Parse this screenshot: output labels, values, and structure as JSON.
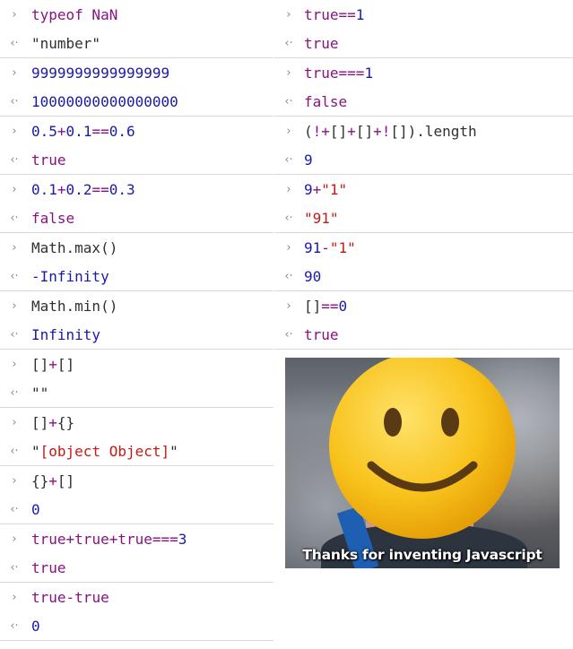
{
  "prompt_glyph": "›",
  "result_glyph": "‹·",
  "left": [
    {
      "input": [
        {
          "t": "typeof NaN",
          "c": "purple"
        }
      ],
      "output": [
        {
          "t": "\"number\"",
          "c": "black"
        }
      ]
    },
    {
      "input": [
        {
          "t": "9999999999999999",
          "c": "blue"
        }
      ],
      "output": [
        {
          "t": "10000000000000000",
          "c": "blue"
        }
      ]
    },
    {
      "input": [
        {
          "t": "0.5",
          "c": "blue"
        },
        {
          "t": "+",
          "c": "op"
        },
        {
          "t": "0.1",
          "c": "blue"
        },
        {
          "t": "==",
          "c": "op"
        },
        {
          "t": "0.6",
          "c": "blue"
        }
      ],
      "output": [
        {
          "t": "true",
          "c": "purple"
        }
      ]
    },
    {
      "input": [
        {
          "t": "0.1",
          "c": "blue"
        },
        {
          "t": "+",
          "c": "op"
        },
        {
          "t": "0.2",
          "c": "blue"
        },
        {
          "t": "==",
          "c": "op"
        },
        {
          "t": "0.3",
          "c": "blue"
        }
      ],
      "output": [
        {
          "t": "false",
          "c": "purple"
        }
      ]
    },
    {
      "input": [
        {
          "t": "Math.max()",
          "c": "black"
        }
      ],
      "output": [
        {
          "t": "-Infinity",
          "c": "blue"
        }
      ]
    },
    {
      "input": [
        {
          "t": "Math.min()",
          "c": "black"
        }
      ],
      "output": [
        {
          "t": "Infinity",
          "c": "blue"
        }
      ]
    },
    {
      "input": [
        {
          "t": "[]",
          "c": "black"
        },
        {
          "t": "+",
          "c": "op"
        },
        {
          "t": "[]",
          "c": "black"
        }
      ],
      "output": [
        {
          "t": "\"\"",
          "c": "black"
        }
      ]
    },
    {
      "input": [
        {
          "t": "[]",
          "c": "black"
        },
        {
          "t": "+",
          "c": "op"
        },
        {
          "t": "{}",
          "c": "black"
        }
      ],
      "output": [
        {
          "t": "\"",
          "c": "black"
        },
        {
          "t": "[object Object]",
          "c": "red"
        },
        {
          "t": "\"",
          "c": "black"
        }
      ]
    },
    {
      "input": [
        {
          "t": "{}",
          "c": "black"
        },
        {
          "t": "+",
          "c": "op"
        },
        {
          "t": "[]",
          "c": "black"
        }
      ],
      "output": [
        {
          "t": "0",
          "c": "blue"
        }
      ]
    },
    {
      "input": [
        {
          "t": "true",
          "c": "purple"
        },
        {
          "t": "+",
          "c": "op"
        },
        {
          "t": "true",
          "c": "purple"
        },
        {
          "t": "+",
          "c": "op"
        },
        {
          "t": "true",
          "c": "purple"
        },
        {
          "t": "===",
          "c": "op"
        },
        {
          "t": "3",
          "c": "blue"
        }
      ],
      "output": [
        {
          "t": "true",
          "c": "purple"
        }
      ]
    },
    {
      "input": [
        {
          "t": "true",
          "c": "purple"
        },
        {
          "t": "-",
          "c": "op"
        },
        {
          "t": "true",
          "c": "purple"
        }
      ],
      "output": [
        {
          "t": "0",
          "c": "blue"
        }
      ]
    }
  ],
  "right": [
    {
      "input": [
        {
          "t": "true",
          "c": "purple"
        },
        {
          "t": "==",
          "c": "op"
        },
        {
          "t": "1",
          "c": "blue"
        }
      ],
      "output": [
        {
          "t": "true",
          "c": "purple"
        }
      ]
    },
    {
      "input": [
        {
          "t": "true",
          "c": "purple"
        },
        {
          "t": "===",
          "c": "op"
        },
        {
          "t": "1",
          "c": "blue"
        }
      ],
      "output": [
        {
          "t": "false",
          "c": "purple"
        }
      ]
    },
    {
      "input": [
        {
          "t": "(",
          "c": "black"
        },
        {
          "t": "!+",
          "c": "op"
        },
        {
          "t": "[]",
          "c": "black"
        },
        {
          "t": "+",
          "c": "op"
        },
        {
          "t": "[]",
          "c": "black"
        },
        {
          "t": "+!",
          "c": "op"
        },
        {
          "t": "[]).length",
          "c": "black"
        }
      ],
      "output": [
        {
          "t": "9",
          "c": "blue"
        }
      ]
    },
    {
      "input": [
        {
          "t": "9",
          "c": "blue"
        },
        {
          "t": "+",
          "c": "op"
        },
        {
          "t": "\"1\"",
          "c": "red"
        }
      ],
      "output": [
        {
          "t": "\"91\"",
          "c": "red"
        }
      ]
    },
    {
      "input": [
        {
          "t": "91",
          "c": "blue"
        },
        {
          "t": "-",
          "c": "op"
        },
        {
          "t": "\"1\"",
          "c": "red"
        }
      ],
      "output": [
        {
          "t": "90",
          "c": "blue"
        }
      ]
    },
    {
      "input": [
        {
          "t": "[]",
          "c": "black"
        },
        {
          "t": "==",
          "c": "op"
        },
        {
          "t": "0",
          "c": "blue"
        }
      ],
      "output": [
        {
          "t": "true",
          "c": "purple"
        }
      ]
    }
  ],
  "meme": {
    "caption": "Thanks for inventing Javascript",
    "emoji": "slightly-smiling-face-icon"
  },
  "colors": {
    "purple": "#881280",
    "blue": "#1a1aa6",
    "red": "#c41a16",
    "text": "#303030",
    "divider": "#d8d8d8"
  }
}
